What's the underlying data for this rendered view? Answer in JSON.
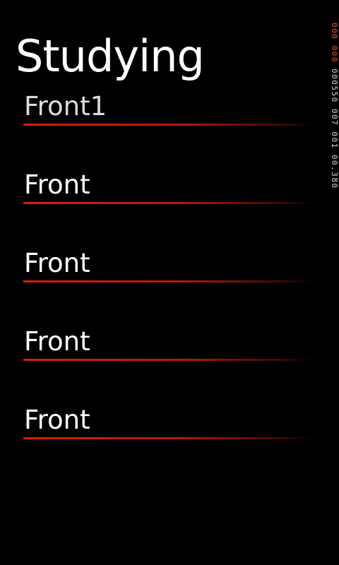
{
  "page": {
    "title": "Studying"
  },
  "cards": [
    {
      "front": "Front1"
    },
    {
      "front": "Front"
    },
    {
      "front": "Front"
    },
    {
      "front": "Front"
    },
    {
      "front": "Front"
    }
  ],
  "frame_rate_counter": {
    "accent_values": [
      "000",
      "000"
    ],
    "values": [
      "000550",
      "007",
      "001",
      "00.380"
    ]
  },
  "colors": {
    "background": "#000000",
    "text": "#ffffff",
    "accent": "#d81e05",
    "counter_accent": "#e8572a"
  }
}
